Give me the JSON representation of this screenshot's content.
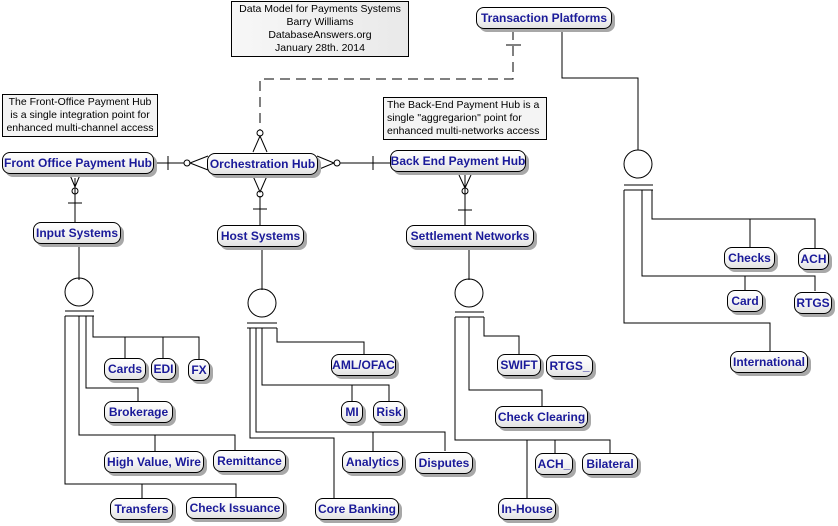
{
  "title_block": {
    "lines": [
      "Data Model for Payments Systems",
      "Barry Williams",
      "DatabaseAnswers.org",
      "January 28th. 2014"
    ]
  },
  "notes": {
    "front_office": [
      "The Front-Office Payment Hub",
      "is a single integration point for",
      "enhanced multi-channel access"
    ],
    "back_end": [
      "The Back-End Payment Hub is a",
      "single \"aggregarion\" point for",
      "enhanced multi-networks access"
    ]
  },
  "entities": {
    "transaction_platforms": "Transaction Platforms",
    "front_office_payment_hub": "Front Office Payment Hub",
    "orchestration_hub": "Orchestration Hub",
    "back_end_payment_hub": "Back End Payment Hub",
    "input_systems": "Input Systems",
    "host_systems": "Host Systems",
    "settlement_networks": "Settlement Networks",
    "cards": "Cards",
    "edi": "EDI",
    "fx": "FX",
    "brokerage": "Brokerage",
    "high_value_wire": "High Value, Wire",
    "remittance": "Remittance",
    "transfers": "Transfers",
    "check_issuance": "Check Issuance",
    "aml_ofac": "AML/OFAC",
    "mi": "MI",
    "risk": "Risk",
    "analytics": "Analytics",
    "disputes": "Disputes",
    "core_banking": "Core Banking",
    "swift": "SWIFT",
    "rtgs_": "RTGS_",
    "check_clearing": "Check Clearing",
    "ach_": "ACH_",
    "bilateral": "Bilateral",
    "in_house": "In-House",
    "checks": "Checks",
    "ach": "ACH",
    "card": "Card",
    "rtgs": "RTGS",
    "international": "International"
  },
  "colors": {
    "entity_text": "#1a1a99",
    "line": "#000000",
    "shadow": "#a8a8a8"
  }
}
